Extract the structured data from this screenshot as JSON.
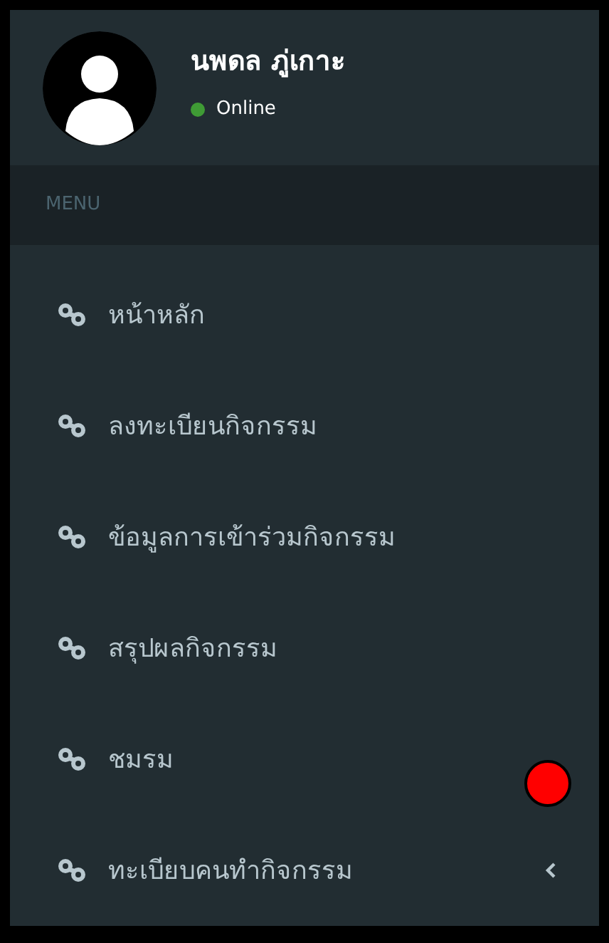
{
  "user": {
    "name": "นพดล ภู่เกาะ",
    "status": {
      "label": "Online",
      "color": "#3f9b35"
    }
  },
  "menu": {
    "header": "MENU",
    "items": [
      {
        "label": "หน้าหลัก",
        "has_submenu": false
      },
      {
        "label": "ลงทะเบียนกิจกรรม",
        "has_submenu": false
      },
      {
        "label": "ข้อมูลการเข้าร่วมกิจกรรม",
        "has_submenu": false
      },
      {
        "label": "สรุปผลกิจกรรม",
        "has_submenu": false
      },
      {
        "label": "ชมรม",
        "has_submenu": false
      },
      {
        "label": "ทะเบียบคนทำกิจกรรม",
        "has_submenu": true
      }
    ]
  }
}
